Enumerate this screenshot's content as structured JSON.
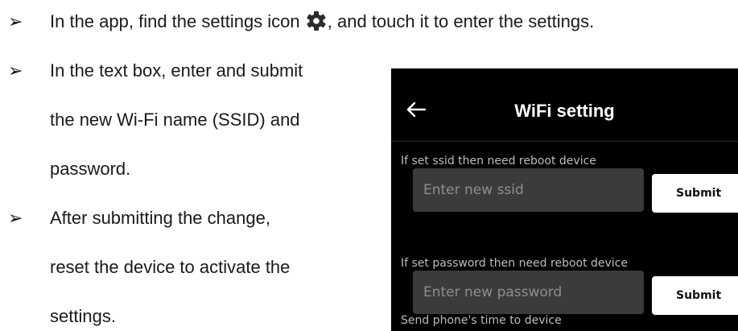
{
  "bullets": [
    {
      "text_before_icon": "In the app, find the settings icon",
      "icon": "gear-icon",
      "text_after_icon": ", and touch it to enter the settings."
    },
    {
      "lines": [
        "In the text box, enter and submit",
        "the new Wi-Fi name (SSID) and",
        "password."
      ]
    },
    {
      "lines": [
        "After submitting the change,",
        "reset the device to activate the",
        "settings."
      ]
    }
  ],
  "bullet_symbol": "➢",
  "phone": {
    "title": "WiFi setting",
    "back_icon": "back-arrow-icon",
    "ssid_caption": "If set ssid then need reboot device",
    "ssid_placeholder": "Enter new ssid",
    "ssid_submit": "Submit",
    "password_caption": "If set password then need reboot device",
    "password_placeholder": "Enter new password",
    "password_submit": "Submit",
    "time_caption": "Send phone's time to device",
    "colors": {
      "background": "#000000",
      "field": "#3b3b3b",
      "button": "#ffffff"
    }
  }
}
